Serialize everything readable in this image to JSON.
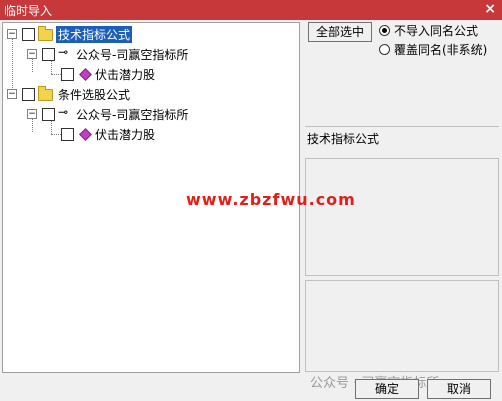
{
  "window": {
    "title": "临时导入",
    "close": "×"
  },
  "tree": {
    "nodes": [
      {
        "label": "技术指标公式",
        "selected": true
      },
      {
        "label": "公众号-司赢空指标所"
      },
      {
        "label": "伏击潜力股"
      },
      {
        "label": "条件选股公式"
      },
      {
        "label": "公众号-司赢空指标所"
      },
      {
        "label": "伏击潜力股"
      }
    ]
  },
  "options": {
    "select_all": "全部选中",
    "radio_no_import": "不导入同名公式",
    "radio_overwrite": "覆盖同名(非系统)"
  },
  "info": {
    "label": "技术指标公式"
  },
  "watermark": "www.zbzfwu.com",
  "overlay_caption": "公众号 · 司赢空指标所",
  "footer": {
    "ok": "确定",
    "cancel": "取消"
  }
}
